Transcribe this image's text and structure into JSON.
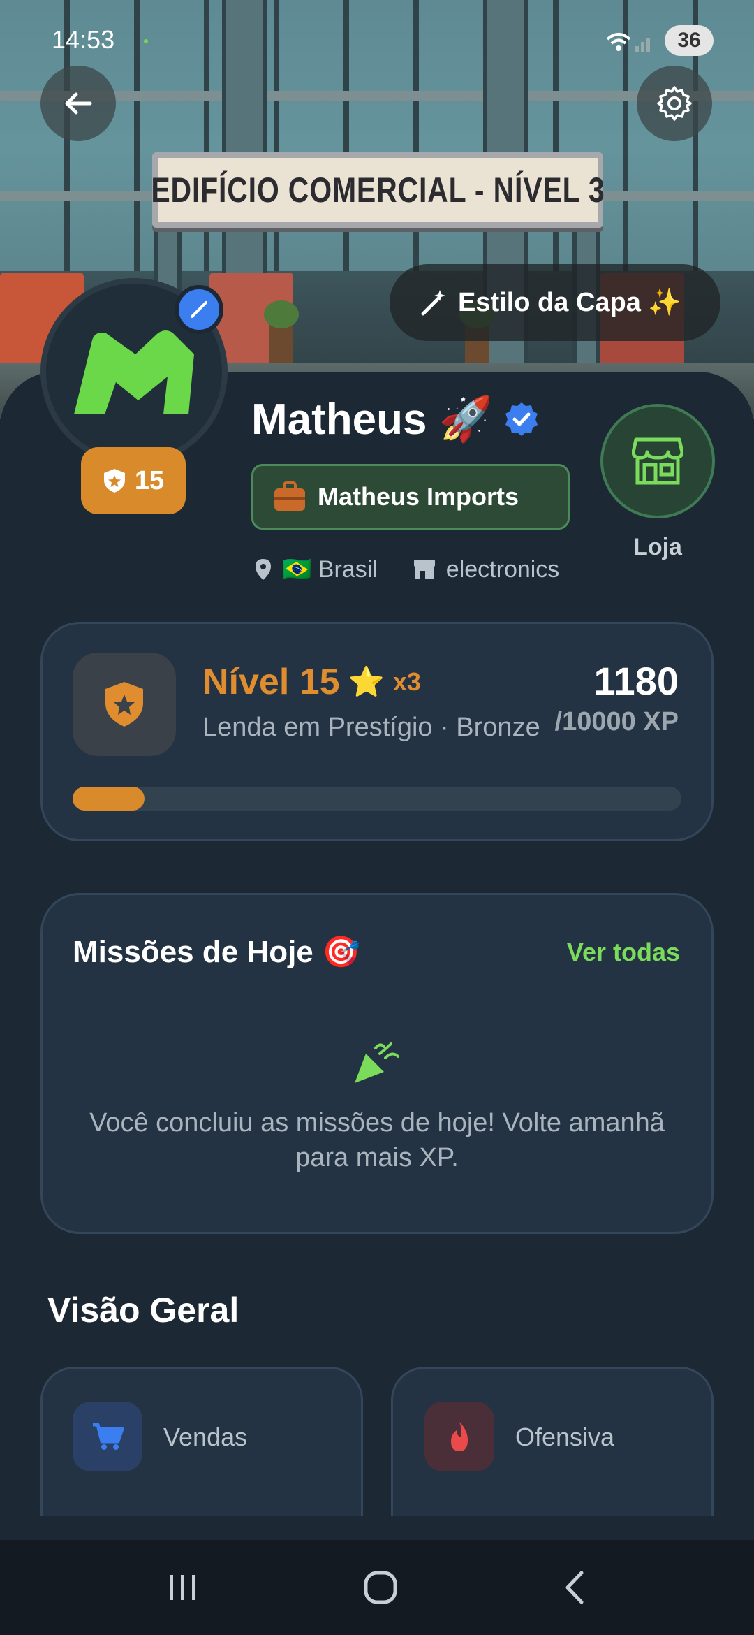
{
  "status_bar": {
    "time": "14:53",
    "battery": "36"
  },
  "cover": {
    "sign_text": "EDIFÍCIO COMERCIAL - NÍVEL 3",
    "style_button": "Estilo da Capa ✨"
  },
  "profile": {
    "name": "Matheus 🚀",
    "level_badge": "15",
    "company": "Matheus Imports",
    "country": "🇧🇷 Brasil",
    "category": "electronics",
    "shop_label": "Loja"
  },
  "level_card": {
    "title": "Nível 15",
    "star": "⭐",
    "multiplier": "x3",
    "subtitle": "Lenda em Prestígio · Bronze",
    "xp_current": "1180",
    "xp_total": "/10000 XP",
    "progress": 0.118
  },
  "missions": {
    "title": "Missões de Hoje 🎯",
    "see_all": "Ver todas",
    "empty_message": "Você concluiu as missões de hoje! Volte amanhã para mais XP."
  },
  "overview": {
    "title": "Visão Geral",
    "stats": [
      {
        "label": "Vendas"
      },
      {
        "label": "Ofensiva"
      }
    ]
  },
  "colors": {
    "accent_orange": "#d98a2a",
    "accent_green": "#7bdc5c",
    "verified_blue": "#3a7ef0"
  }
}
